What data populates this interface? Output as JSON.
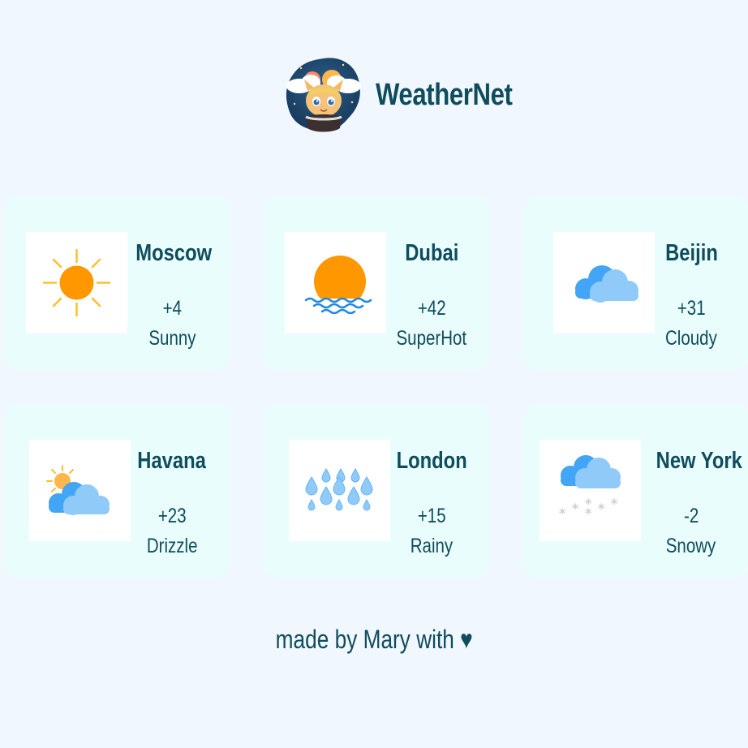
{
  "app": {
    "brand": "WeatherNet"
  },
  "cards": [
    {
      "city": "Moscow",
      "temp": "+4",
      "desc": "Sunny",
      "icon": "sun-icon"
    },
    {
      "city": "Dubai",
      "temp": "+42",
      "desc": "SuperHot",
      "icon": "sunset-icon"
    },
    {
      "city": "Beijin",
      "temp": "+31",
      "desc": "Cloudy",
      "icon": "cloud-icon"
    },
    {
      "city": "Havana",
      "temp": "+23",
      "desc": "Drizzle",
      "icon": "sun-behind-cloud-icon"
    },
    {
      "city": "London",
      "temp": "+15",
      "desc": "Rainy",
      "icon": "raindrops-icon"
    },
    {
      "city": "New York",
      "temp": "-2",
      "desc": "Snowy",
      "icon": "snow-cloud-icon"
    }
  ],
  "footer": {
    "text": "made by Mary with ♥"
  },
  "colors": {
    "page_background": "#f0f7fe",
    "card_background": "#eafdfd",
    "text": "#0f4c5c",
    "sun": "#ff9800",
    "sun_rays": "#fbc02d",
    "cloud_dark": "#42a5f5",
    "cloud_light": "#90caf9",
    "water": "#1e88e5",
    "snow": "#cfcfcf"
  }
}
